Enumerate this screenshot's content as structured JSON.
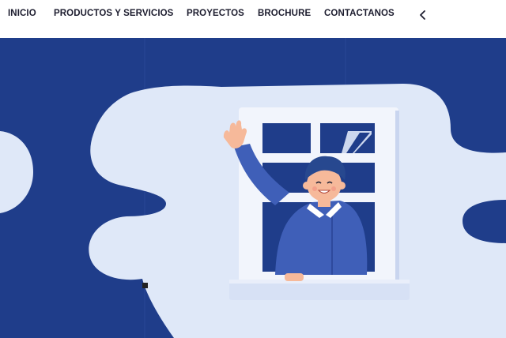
{
  "nav": {
    "items": [
      {
        "label": "INICIO"
      },
      {
        "label": "PRODUCTOS Y SERVICIOS"
      },
      {
        "label": "PROYECTOS"
      },
      {
        "label": "BROCHURE"
      },
      {
        "label": "CONTACTANOS"
      }
    ],
    "back_icon": "chevron-left-icon"
  },
  "hero": {
    "illustration": "man-waving-from-window-illustration"
  },
  "colors": {
    "hero_background": "#1f3d8a",
    "cloud": "#dfe8f8",
    "window_frame": "#f2f5fc",
    "window_glass": "#1f3d8a",
    "shirt": "#3f5fb8",
    "hair": "#27488f",
    "skin": "#f6b99a"
  }
}
